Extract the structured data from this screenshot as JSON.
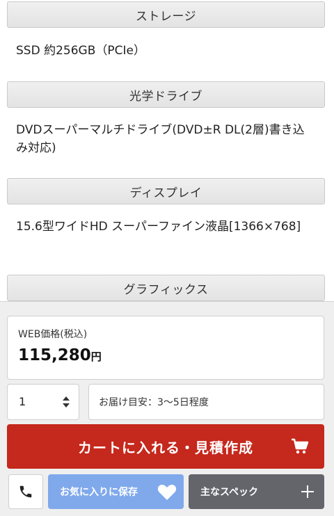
{
  "specs": [
    {
      "header": "ストレージ",
      "value": "SSD 約256GB（PCIe）"
    },
    {
      "header": "光学ドライブ",
      "value": "DVDスーパーマルチドライブ(DVD±R DL(2層)書き込み対応)"
    },
    {
      "header": "ディスプレイ",
      "value": "15.6型ワイドHD スーパーファイン液晶[1366×768]"
    },
    {
      "header": "グラフィックス"
    }
  ],
  "purchase": {
    "price_label": "WEB価格(税込)",
    "price_value": "115,280",
    "price_unit": "円",
    "quantity": "1",
    "delivery": "お届け目安：3〜5日程度",
    "cart_button": "カートに入れる・見積作成",
    "favorite_button": "お気に入りに保存",
    "specs_button": "主なスペック"
  },
  "colors": {
    "cart_button": "#c5281c",
    "favorite_button": "#80a9ec",
    "specs_button": "#63656b",
    "header_bg": "#e8e8e8"
  },
  "icons": [
    "phone-icon",
    "cart-icon",
    "heart-icon",
    "plus-icon",
    "up-down-arrows-icon"
  ]
}
